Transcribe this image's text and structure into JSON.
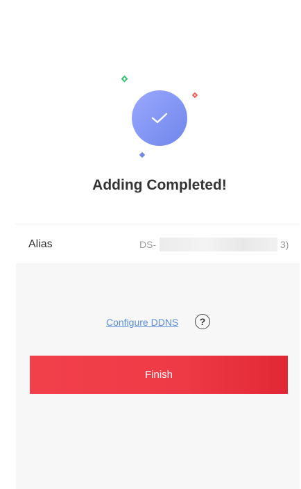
{
  "result": {
    "title": "Adding Completed!"
  },
  "device": {
    "alias_label": "Alias",
    "alias_value_prefix": "DS-",
    "alias_value_suffix": "3)"
  },
  "actions": {
    "configure_ddns": "Configure DDNS",
    "help_symbol": "?",
    "finish": "Finish"
  },
  "icons": {
    "success": "checkmark-icon",
    "help": "question-circle-icon"
  },
  "colors": {
    "accent_red": "#ee3a45",
    "success_blue": "#7f93f0",
    "link_blue": "#5b8dd8"
  }
}
